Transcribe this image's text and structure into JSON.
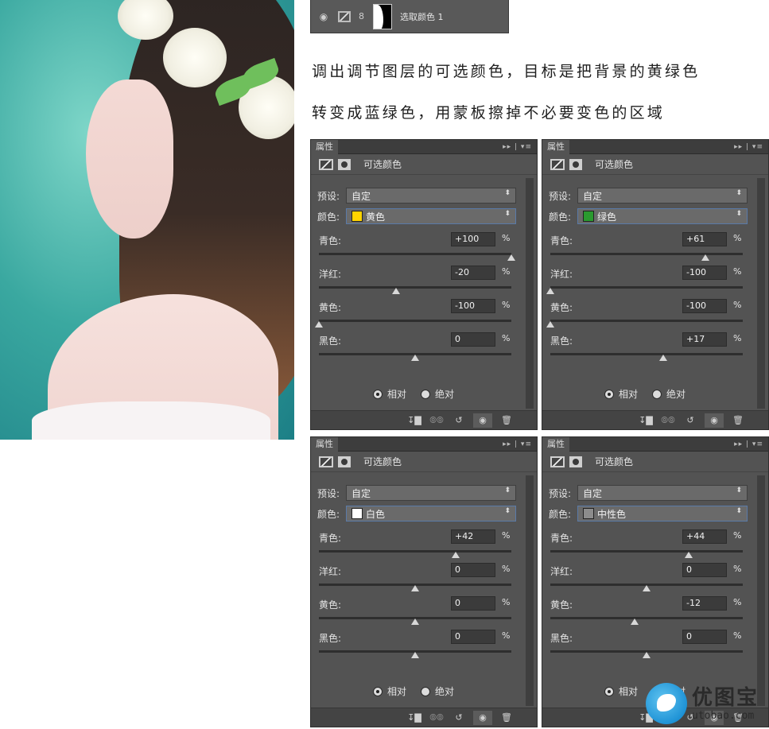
{
  "layer": {
    "name": "选取颜色 1"
  },
  "caption": {
    "line1": "调出调节图层的可选颜色，目标是把背景的黄绿色",
    "line2": "转变成蓝绿色，用蒙板擦掉不必要变色的区域"
  },
  "panels": [
    {
      "tab": "属性",
      "title": "可选颜色",
      "preset_label": "预设:",
      "preset_value": "自定",
      "color_label": "颜色:",
      "color_value": "黄色",
      "swatch": "#ffd400",
      "sliders": [
        {
          "label": "青色:",
          "value": "+100",
          "num": 100
        },
        {
          "label": "洋红:",
          "value": "-20",
          "num": -20
        },
        {
          "label": "黄色:",
          "value": "-100",
          "num": -100
        },
        {
          "label": "黑色:",
          "value": "0",
          "num": 0
        }
      ],
      "relative": "相对",
      "absolute": "绝对"
    },
    {
      "tab": "属性",
      "title": "可选颜色",
      "preset_label": "预设:",
      "preset_value": "自定",
      "color_label": "颜色:",
      "color_value": "绿色",
      "swatch": "#2a9a2f",
      "sliders": [
        {
          "label": "青色:",
          "value": "+61",
          "num": 61
        },
        {
          "label": "洋红:",
          "value": "-100",
          "num": -100
        },
        {
          "label": "黄色:",
          "value": "-100",
          "num": -100
        },
        {
          "label": "黑色:",
          "value": "+17",
          "num": 17
        }
      ],
      "relative": "相对",
      "absolute": "绝对"
    },
    {
      "tab": "属性",
      "title": "可选颜色",
      "preset_label": "预设:",
      "preset_value": "自定",
      "color_label": "颜色:",
      "color_value": "白色",
      "swatch": "#ffffff",
      "sliders": [
        {
          "label": "青色:",
          "value": "+42",
          "num": 42
        },
        {
          "label": "洋红:",
          "value": "0",
          "num": 0
        },
        {
          "label": "黄色:",
          "value": "0",
          "num": 0
        },
        {
          "label": "黑色:",
          "value": "0",
          "num": 0
        }
      ],
      "relative": "相对",
      "absolute": "绝对"
    },
    {
      "tab": "属性",
      "title": "可选颜色",
      "preset_label": "预设:",
      "preset_value": "自定",
      "color_label": "颜色:",
      "color_value": "中性色",
      "swatch": "#8c8c8c",
      "sliders": [
        {
          "label": "青色:",
          "value": "+44",
          "num": 44
        },
        {
          "label": "洋红:",
          "value": "0",
          "num": 0
        },
        {
          "label": "黄色:",
          "value": "-12",
          "num": -12
        },
        {
          "label": "黑色:",
          "value": "0",
          "num": 0
        }
      ],
      "relative": "相对",
      "absolute": "绝对"
    }
  ],
  "watermark": {
    "brand": "优图宝",
    "url": "utobao.com"
  },
  "icons": {
    "visibility": "eye-icon",
    "adjustment": "selective-color-icon",
    "mask": "mask-icon",
    "chain": "link-icon"
  }
}
